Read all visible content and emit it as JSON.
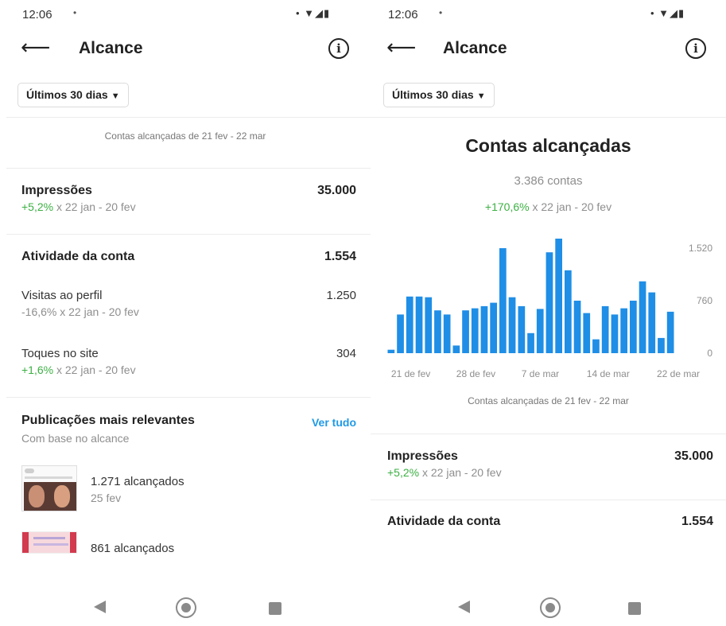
{
  "left": {
    "status_time": "12:06",
    "status_dot": "•",
    "status_icons": "• ▼◢▮",
    "header": {
      "title": "Alcance",
      "info": "i"
    },
    "period_button": {
      "label": "Últimos 30 dias",
      "chevron": "▼"
    },
    "range_caption": "Contas alcançadas de 21 fev - 22 mar",
    "impressions": {
      "title": "Impressões",
      "value": "35.000",
      "change": "+5,2%",
      "compare": " x 22 jan - 20 fev"
    },
    "activity": {
      "title": "Atividade da conta",
      "value": "1.554"
    },
    "profile_visits": {
      "label": "Visitas ao perfil",
      "value": "1.250",
      "change": "-16,6% x 22 jan - 20 fev"
    },
    "site_taps": {
      "label": "Toques no site",
      "value": "304",
      "change": "+1,6%",
      "compare": " x 22 jan - 20 fev"
    },
    "top_posts": {
      "title": "Publicações mais relevantes",
      "see_all": "Ver tudo",
      "subtitle": "Com base no alcance",
      "posts": [
        {
          "reach": "1.271 alcançados",
          "date": "25 fev"
        },
        {
          "reach": "861 alcançados"
        }
      ]
    }
  },
  "right": {
    "status_time": "12:06",
    "status_dot": "•",
    "status_icons": "• ▼◢▮",
    "header": {
      "title": "Alcance",
      "info": "i"
    },
    "period_button": {
      "label": "Últimos 30 dias",
      "chevron": "▼"
    },
    "reach": {
      "title": "Contas alcançadas",
      "count": "3.386 contas",
      "change": "+170,6%",
      "compare": " x 22 jan - 20 fev"
    },
    "range_caption": "Contas alcançadas de 21 fev - 22 mar",
    "impressions": {
      "title": "Impressões",
      "value": "35.000",
      "change": "+5,2%",
      "compare": " x 22 jan - 20 fev"
    },
    "activity": {
      "title": "Atividade da conta",
      "value": "1.554"
    }
  },
  "colors": {
    "bar": "#1f8ee6",
    "positive": "#3cb043",
    "link": "#1f9ae6"
  },
  "chart_data": {
    "type": "bar",
    "categories": [
      "21 de fev",
      "22 fev",
      "23 fev",
      "24 fev",
      "25 fev",
      "26 fev",
      "27 fev",
      "28 de fev",
      "1 mar",
      "2 mar",
      "3 mar",
      "4 mar",
      "5 mar",
      "6 mar",
      "7 de mar",
      "8 mar",
      "9 mar",
      "10 mar",
      "11 mar",
      "12 mar",
      "13 mar",
      "14 de mar",
      "15 mar",
      "16 mar",
      "17 mar",
      "18 mar",
      "19 mar",
      "20 mar",
      "21 mar",
      "22 de mar"
    ],
    "values": [
      50,
      560,
      820,
      820,
      810,
      620,
      560,
      110,
      620,
      650,
      680,
      730,
      1520,
      810,
      680,
      290,
      640,
      1460,
      1780,
      1200,
      760,
      580,
      200,
      680,
      560,
      650,
      760,
      1040,
      880,
      220,
      600
    ],
    "x_tick_labels": [
      "21 de fev",
      "28 de fev",
      "7 de mar",
      "14 de mar",
      "22 de mar"
    ],
    "y_tick_labels": [
      "1.520",
      "760",
      "0"
    ],
    "ylim": [
      0,
      1520
    ],
    "grid": false
  }
}
